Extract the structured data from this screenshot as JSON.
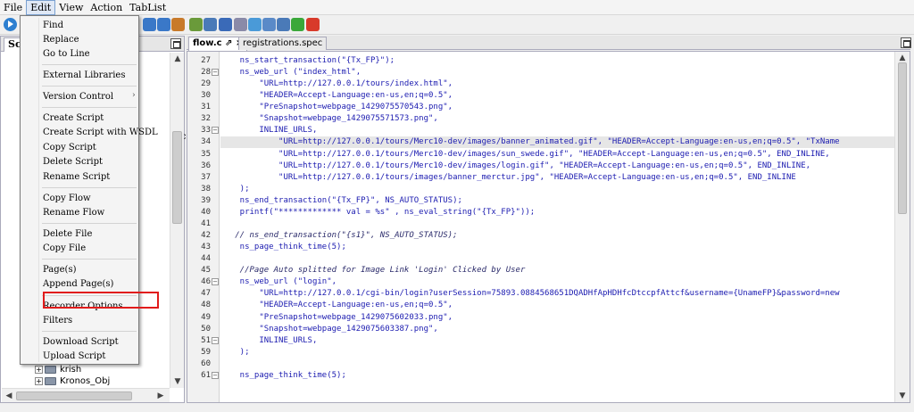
{
  "menubar": {
    "items": [
      {
        "label": "File"
      },
      {
        "label": "Edit"
      },
      {
        "label": "View"
      },
      {
        "label": "Action"
      },
      {
        "label": "TabList"
      }
    ]
  },
  "toolbar": {
    "buttons": [
      {
        "icon": "run-icon",
        "color": "#2d7fd0"
      },
      {
        "icon": "arrow-down-icon",
        "color": "#3a78c8"
      },
      {
        "icon": "arrow-up-icon",
        "color": "#3a78c8"
      },
      {
        "icon": "tools-icon",
        "color": "#c87a2a"
      },
      {
        "icon": "record-icon",
        "color": "#6a9a3a"
      },
      {
        "icon": "search-icon",
        "color": "#4a7ab8"
      },
      {
        "icon": "settings-icon",
        "color": "#3a6ab8"
      },
      {
        "icon": "document-icon",
        "color": "#8a8aa8"
      },
      {
        "icon": "globe-icon",
        "color": "#4a9ad8"
      },
      {
        "icon": "window-icon",
        "color": "#5a8ac8"
      },
      {
        "icon": "save-icon",
        "color": "#4a7ab8"
      },
      {
        "icon": "refresh-icon",
        "color": "#3aa83a"
      },
      {
        "icon": "stop-icon",
        "color": "#d83a2a"
      }
    ]
  },
  "left_panel": {
    "tab_label": "Scr",
    "tree": [
      {
        "label": "krish"
      },
      {
        "label": "Kronos_Obj"
      }
    ],
    "stub_text": "ec"
  },
  "editor_tabs": [
    {
      "label": "flow.c",
      "pin": "⇗",
      "close": "×"
    },
    {
      "label": "registrations.spec"
    }
  ],
  "edit_menu": {
    "items": [
      {
        "label": "Find",
        "submenu": false
      },
      {
        "label": "Replace",
        "submenu": false
      },
      {
        "label": "Go to Line",
        "submenu": false
      },
      {
        "label": "External Libraries",
        "submenu": false
      },
      {
        "label": "Version Control",
        "submenu": true
      },
      {
        "label": "Create Script",
        "submenu": false
      },
      {
        "label": "Create Script with WSDL",
        "submenu": false
      },
      {
        "label": "Copy Script",
        "submenu": false
      },
      {
        "label": "Delete Script",
        "submenu": false
      },
      {
        "label": "Rename Script",
        "submenu": false
      },
      {
        "label": "Copy Flow",
        "submenu": false
      },
      {
        "label": "Rename Flow",
        "submenu": false
      },
      {
        "label": "Delete File",
        "submenu": false
      },
      {
        "label": "Copy File",
        "submenu": false
      },
      {
        "label": "Page(s)",
        "submenu": false
      },
      {
        "label": "Append Page(s)",
        "submenu": false,
        "highlighted": true
      },
      {
        "label": "Recorder Options",
        "submenu": false
      },
      {
        "label": "Filters",
        "submenu": false
      },
      {
        "label": "Download Script",
        "submenu": false
      },
      {
        "label": "Upload Script",
        "submenu": false
      }
    ],
    "highlight_color": "#e11b1b"
  },
  "code": {
    "lines": [
      {
        "num": "27",
        "fold": "",
        "text": "    ns_start_transaction(\"{Tx_FP}\");",
        "hl": false
      },
      {
        "num": "28",
        "fold": "−",
        "text": "    ns_web_url (\"index_html\",",
        "hl": false
      },
      {
        "num": "29",
        "fold": "",
        "text": "        \"URL=http://127.0.0.1/tours/index.html\",",
        "hl": false
      },
      {
        "num": "30",
        "fold": "",
        "text": "        \"HEADER=Accept-Language:en-us,en;q=0.5\",",
        "hl": false
      },
      {
        "num": "31",
        "fold": "",
        "text": "        \"PreSnapshot=webpage_1429075570543.png\",",
        "hl": false
      },
      {
        "num": "32",
        "fold": "",
        "text": "        \"Snapshot=webpage_1429075571573.png\",",
        "hl": false
      },
      {
        "num": "33",
        "fold": "−",
        "text": "        INLINE_URLS,",
        "hl": false
      },
      {
        "num": "34",
        "fold": "",
        "text": "            \"URL=http://127.0.0.1/tours/Merc10-dev/images/banner_animated.gif\", \"HEADER=Accept-Language:en-us,en;q=0.5\", \"TxName",
        "hl": true
      },
      {
        "num": "35",
        "fold": "",
        "text": "            \"URL=http://127.0.0.1/tours/Merc10-dev/images/sun_swede.gif\", \"HEADER=Accept-Language:en-us,en;q=0.5\", END_INLINE,",
        "hl": false
      },
      {
        "num": "36",
        "fold": "",
        "text": "            \"URL=http://127.0.0.1/tours/Merc10-dev/images/login.gif\", \"HEADER=Accept-Language:en-us,en;q=0.5\", END_INLINE,",
        "hl": false
      },
      {
        "num": "37",
        "fold": "",
        "text": "            \"URL=http://127.0.0.1/tours/images/banner_merctur.jpg\", \"HEADER=Accept-Language:en-us,en;q=0.5\", END_INLINE",
        "hl": false
      },
      {
        "num": "38",
        "fold": "",
        "text": "    );",
        "hl": false
      },
      {
        "num": "39",
        "fold": "",
        "text": "    ns_end_transaction(\"{Tx_FP}\", NS_AUTO_STATUS);",
        "hl": false
      },
      {
        "num": "40",
        "fold": "",
        "text": "    printf(\"************* val = %s\" , ns_eval_string(\"{Tx_FP}\"));",
        "hl": false
      },
      {
        "num": "41",
        "fold": "",
        "text": "",
        "hl": false
      },
      {
        "num": "42",
        "fold": "",
        "text": "   // ns_end_transaction(\"{s1}\", NS_AUTO_STATUS);",
        "hl": false,
        "comment": true
      },
      {
        "num": "43",
        "fold": "",
        "text": "    ns_page_think_time(5);",
        "hl": false
      },
      {
        "num": "44",
        "fold": "",
        "text": "",
        "hl": false
      },
      {
        "num": "45",
        "fold": "",
        "text": "    //Page Auto splitted for Image Link 'Login' Clicked by User",
        "hl": false,
        "comment": true
      },
      {
        "num": "46",
        "fold": "−",
        "text": "    ns_web_url (\"login\",",
        "hl": false
      },
      {
        "num": "47",
        "fold": "",
        "text": "        \"URL=http://127.0.0.1/cgi-bin/login?userSession=75893.0884568651DQADHfApHDHfcDtccpfAttcf&username={UnameFP}&password=new",
        "hl": false
      },
      {
        "num": "48",
        "fold": "",
        "text": "        \"HEADER=Accept-Language:en-us,en;q=0.5\",",
        "hl": false
      },
      {
        "num": "49",
        "fold": "",
        "text": "        \"PreSnapshot=webpage_1429075602033.png\",",
        "hl": false
      },
      {
        "num": "50",
        "fold": "",
        "text": "        \"Snapshot=webpage_1429075603387.png\",",
        "hl": false
      },
      {
        "num": "51",
        "fold": "−",
        "text": "        INLINE_URLS,",
        "hl": false
      },
      {
        "num": "59",
        "fold": "",
        "text": "    );",
        "hl": false
      },
      {
        "num": "60",
        "fold": "",
        "text": "",
        "hl": false
      },
      {
        "num": "61",
        "fold": "−",
        "text": "    ns_page_think_time(5);",
        "hl": false
      }
    ]
  }
}
